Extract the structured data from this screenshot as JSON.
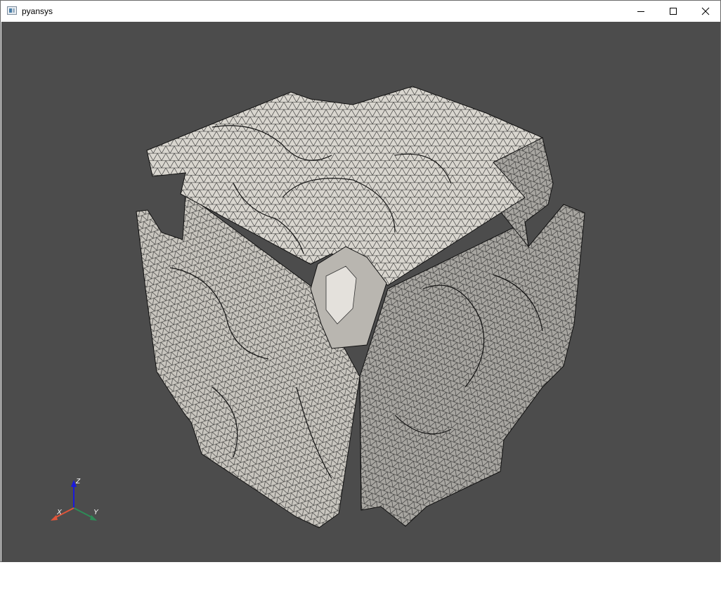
{
  "window": {
    "title": "pyansys"
  },
  "controls": {
    "minimize": "minimize-icon",
    "maximize": "maximize-icon",
    "close": "close-icon"
  },
  "viewport": {
    "background": "#4c4c4c",
    "mesh_fill": "#d9d6cf",
    "mesh_line": "#1e1e1e"
  },
  "axes": {
    "x_label": "X",
    "y_label": "Y",
    "z_label": "Z",
    "x_color": "#e0553a",
    "y_color": "#2e8b57",
    "z_color": "#1a1adb"
  }
}
